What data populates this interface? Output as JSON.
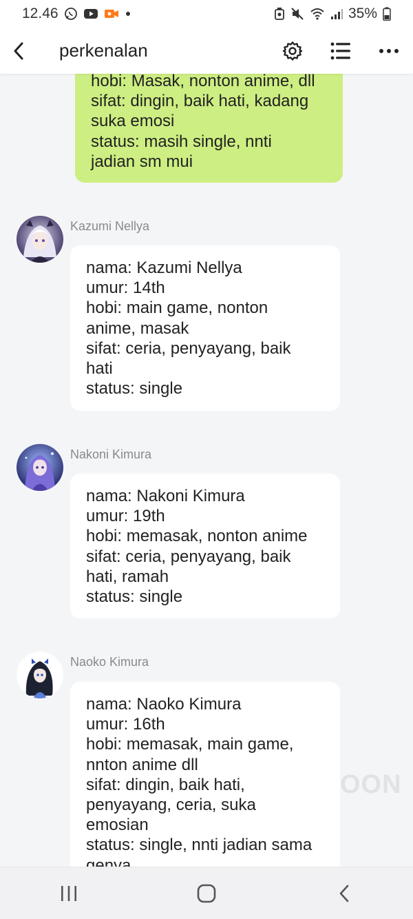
{
  "status_bar": {
    "time": "12.46",
    "battery": "35%"
  },
  "header": {
    "title": "perkenalan"
  },
  "messages": {
    "own": {
      "lines": [
        "hobi: Masak, nonton anime, dll",
        "sifat: dingin, baik hati, kadang",
        "suka emosi",
        "status: masih single, nnti",
        "jadian sm mui"
      ]
    },
    "items": [
      {
        "sender": "Kazumi Nellya",
        "lines": [
          "nama: Kazumi Nellya",
          "umur: 14th",
          "hobi: main game, nonton",
          "anime, masak",
          "sifat: ceria, penyayang, baik",
          "hati",
          "status: single"
        ]
      },
      {
        "sender": "Nakoni Kimura",
        "lines": [
          "nama: Nakoni Kimura",
          "umur: 19th",
          "hobi: memasak, nonton anime",
          "sifat: ceria, penyayang, baik",
          "hati, ramah",
          "status: single"
        ]
      },
      {
        "sender": "Naoko Kimura",
        "lines": [
          "nama: Naoko Kimura",
          "umur: 16th",
          "hobi: memasak, main game,",
          "nnton anime dll",
          "sifat: dingin, baik hati,",
          "penyayang, ceria, suka",
          "emosian",
          "status: single, nnti jadian sama",
          "genya"
        ]
      }
    ]
  },
  "watermark": "OON",
  "colors": {
    "own_bubble": "#cdee82",
    "other_bubble": "#ffffff",
    "background": "#f4f5f7"
  }
}
